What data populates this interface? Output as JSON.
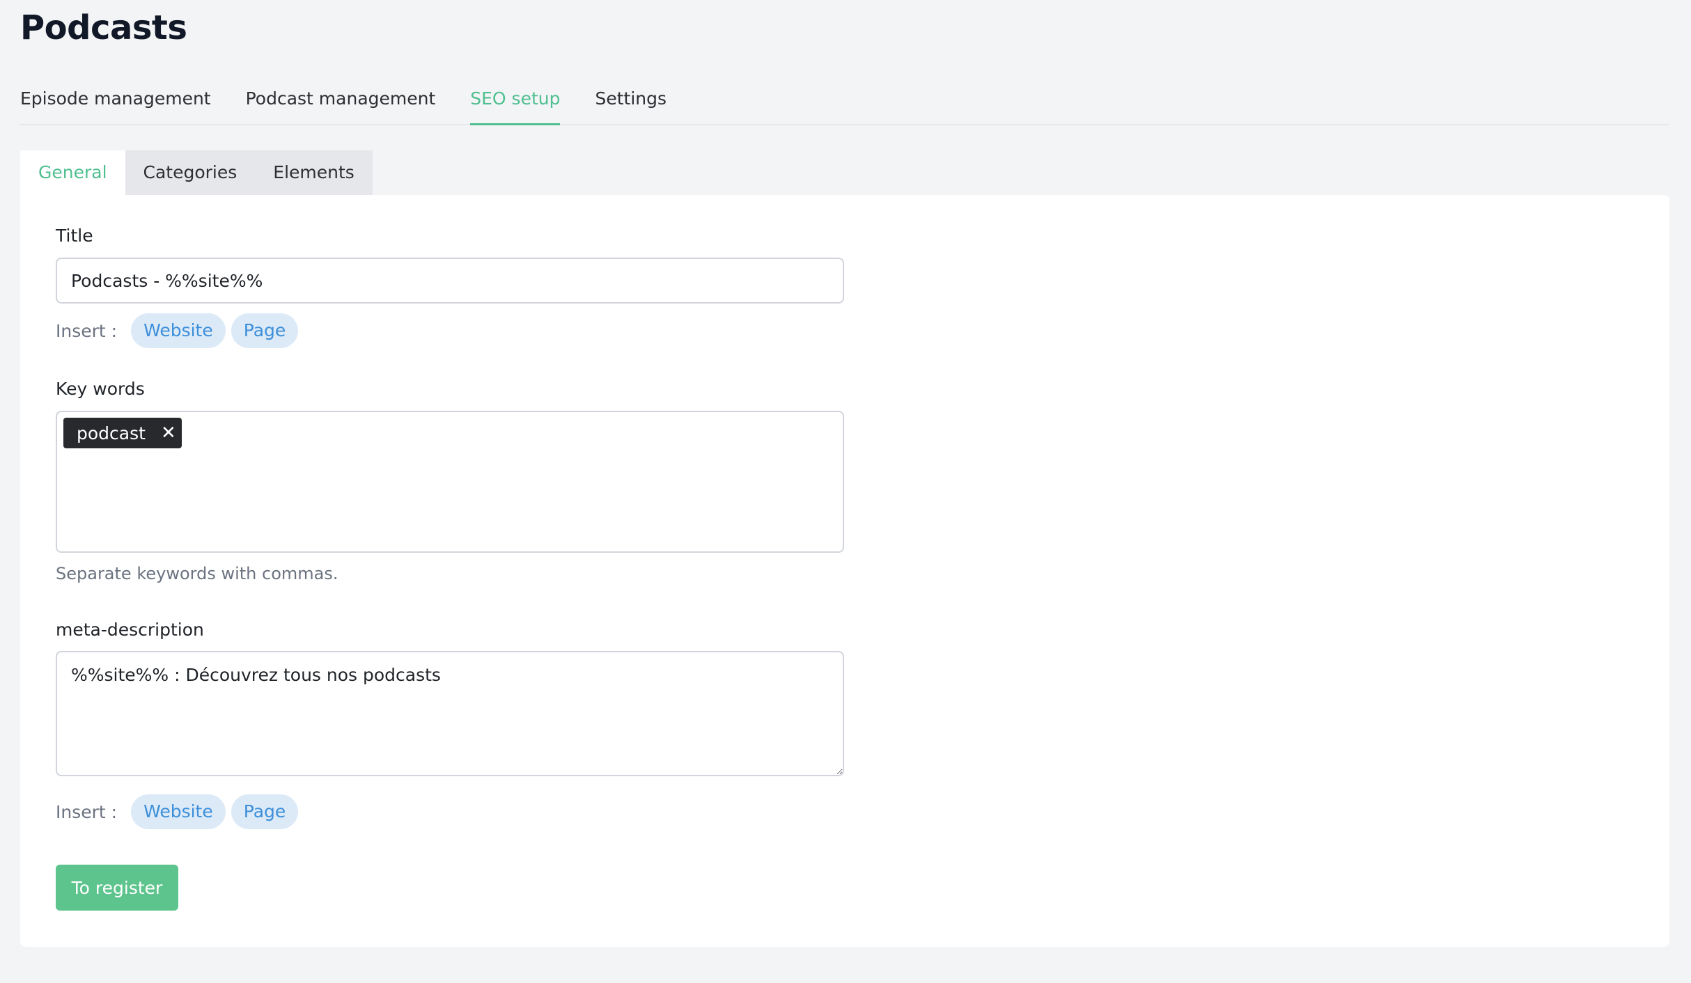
{
  "page": {
    "title": "Podcasts"
  },
  "main_tabs": [
    {
      "label": "Episode management"
    },
    {
      "label": "Podcast management"
    },
    {
      "label": "SEO setup"
    },
    {
      "label": "Settings"
    }
  ],
  "main_tab_active": "SEO setup",
  "sub_tabs": [
    {
      "label": "General"
    },
    {
      "label": "Categories"
    },
    {
      "label": "Elements"
    }
  ],
  "sub_tab_active": "General",
  "form": {
    "title_label": "Title",
    "title_value": "Podcasts - %%site%%",
    "insert_label": "Insert :",
    "insert_website": "Website",
    "insert_page": "Page",
    "keywords_label": "Key words",
    "keywords": [
      {
        "text": "podcast",
        "remove": "✕"
      }
    ],
    "keywords_help": "Separate keywords with commas.",
    "meta_label": "meta-description",
    "meta_value": "%%site%% : Découvrez tous nos podcasts",
    "submit_label": "To register"
  },
  "colors": {
    "accent": "#4fbf8f",
    "button": "#5cc48c",
    "chip_bg": "#dceaf8",
    "chip_text": "#3d8fd9",
    "tag_bg": "#27292d"
  }
}
